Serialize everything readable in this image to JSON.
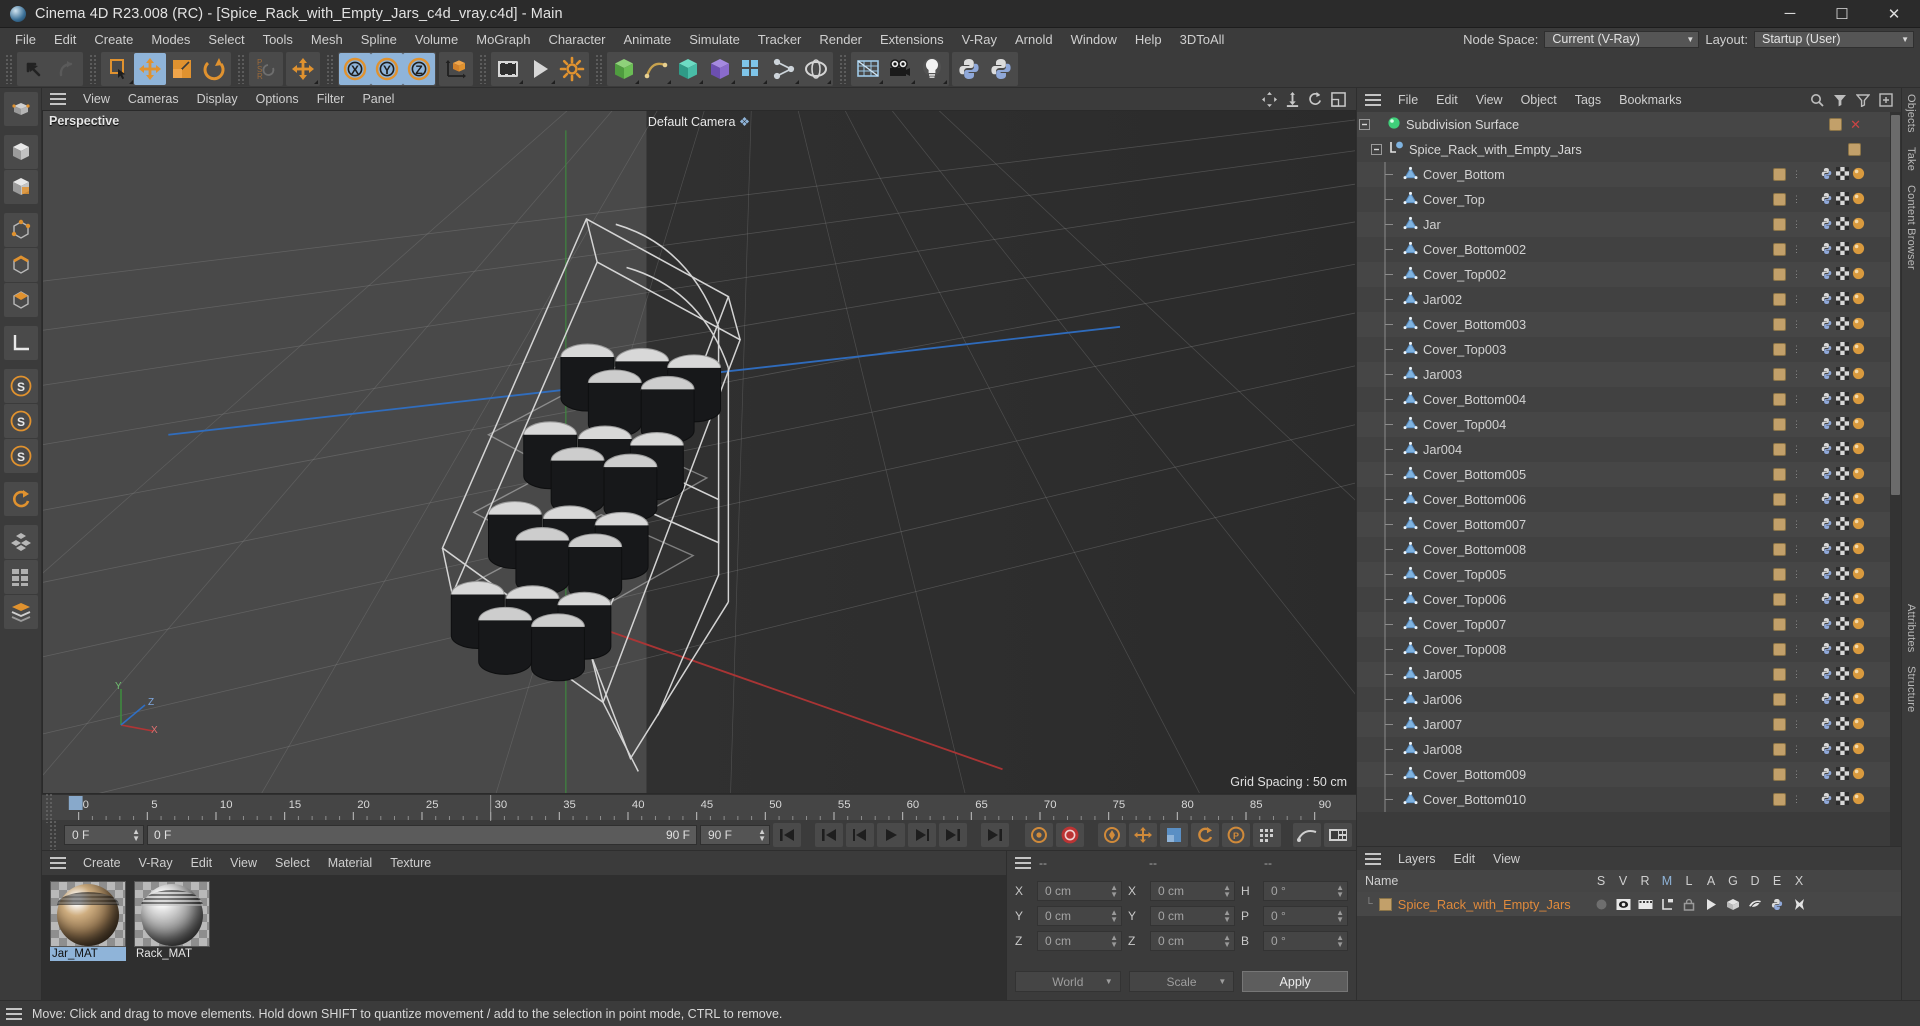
{
  "window": {
    "title": "Cinema 4D R23.008 (RC) - [Spice_Rack_with_Empty_Jars_c4d_vray.c4d] - Main",
    "minimize": "─",
    "maximize": "☐",
    "close": "✕"
  },
  "menubar": {
    "items": [
      "File",
      "Edit",
      "Create",
      "Modes",
      "Select",
      "Tools",
      "Mesh",
      "Spline",
      "Volume",
      "MoGraph",
      "Character",
      "Animate",
      "Simulate",
      "Tracker",
      "Render",
      "Extensions",
      "V-Ray",
      "Arnold",
      "Window",
      "Help",
      "3DToAll"
    ],
    "node_space_label": "Node Space:",
    "node_space_value": "Current (V-Ray)",
    "layout_label": "Layout:",
    "layout_value": "Startup (User)"
  },
  "toolbar": {
    "buttons": [
      {
        "name": "undo-button",
        "icon": "undo-icon",
        "active": false
      },
      {
        "name": "redo-button",
        "icon": "redo-icon",
        "active": false
      },
      {
        "name": "live-selection-button",
        "icon": "selection-icon",
        "active": false
      },
      {
        "name": "move-tool-button",
        "icon": "move-icon",
        "active": true
      },
      {
        "name": "scale-tool-button",
        "icon": "scale-icon",
        "active": false
      },
      {
        "name": "rotate-tool-button",
        "icon": "rotate-icon",
        "active": false
      },
      {
        "name": "psr-button",
        "icon": "psr-icon",
        "active": false
      },
      {
        "name": "move-axis-button",
        "icon": "move-icon",
        "active": false
      },
      {
        "name": "x-axis-lock-button",
        "icon": "x-axis-icon",
        "active": true
      },
      {
        "name": "y-axis-lock-button",
        "icon": "y-axis-icon",
        "active": true
      },
      {
        "name": "z-axis-lock-button",
        "icon": "z-axis-icon",
        "active": true
      },
      {
        "name": "world-object-coordinate-button",
        "icon": "world-axis-icon",
        "active": false
      },
      {
        "name": "render-view-button",
        "icon": "render-view-icon",
        "active": false
      },
      {
        "name": "render-region-button",
        "icon": "render-region-icon",
        "active": false
      },
      {
        "name": "render-settings-button",
        "icon": "render-settings-icon",
        "active": false
      },
      {
        "name": "cube-primitive-button",
        "icon": "cube-icon",
        "active": false
      },
      {
        "name": "spline-pen-button",
        "icon": "spline-icon",
        "active": false
      },
      {
        "name": "generators-button",
        "icon": "generator-icon",
        "active": false
      },
      {
        "name": "bend-deformer-button",
        "icon": "deformer-icon",
        "active": false
      },
      {
        "name": "array-button",
        "icon": "array-icon",
        "active": false
      },
      {
        "name": "scene-nodes-button",
        "icon": "scene-nodes-icon",
        "active": false
      },
      {
        "name": "mograph-button",
        "icon": "mograph-icon",
        "active": false
      },
      {
        "name": "field-button",
        "icon": "field-icon",
        "active": false
      },
      {
        "name": "camera-button",
        "icon": "camera-icon",
        "active": false
      },
      {
        "name": "light-button",
        "icon": "light-icon",
        "active": false
      },
      {
        "name": "python-button",
        "icon": "python-icon",
        "active": false
      },
      {
        "name": "python-generator-button",
        "icon": "python-icon",
        "active": false
      }
    ]
  },
  "lefttools": {
    "buttons": [
      {
        "name": "tool-makeeditable",
        "icon": "make-editable-icon"
      },
      {
        "name": "tool-model-mode",
        "icon": "model-mode-icon"
      },
      {
        "name": "tool-texture-mode",
        "icon": "texture-mode-icon"
      },
      {
        "name": "tool-point-mode",
        "icon": "point-mode-icon"
      },
      {
        "name": "tool-edge-mode",
        "icon": "edge-mode-icon"
      },
      {
        "name": "tool-polygon-mode",
        "icon": "polygon-mode-icon"
      },
      {
        "name": "tool-workplane",
        "icon": "workplane-icon"
      },
      {
        "name": "tool-enable-axis",
        "icon": "axis-icon"
      },
      {
        "name": "tool-snap-s1",
        "icon": "snap-icon"
      },
      {
        "name": "tool-snap-s2",
        "icon": "snap-icon"
      },
      {
        "name": "tool-snap-s3",
        "icon": "snap-icon"
      },
      {
        "name": "tool-quantize",
        "icon": "quantize-icon"
      },
      {
        "name": "tool-workplane-lock",
        "icon": "grid-icon"
      },
      {
        "name": "tool-viewport-solo",
        "icon": "solo-icon"
      },
      {
        "name": "tool-layers",
        "icon": "layers-icon"
      }
    ]
  },
  "viewport": {
    "menu": [
      "View",
      "Cameras",
      "Display",
      "Options",
      "Filter",
      "Panel"
    ],
    "label": "Perspective",
    "camera": "Default Camera",
    "grid_spacing": "Grid Spacing : 50 cm",
    "axis_labels": {
      "x": "X",
      "y": "Y",
      "z": "Z"
    },
    "corner_icons": [
      "pan-view-icon",
      "zoom-view-icon",
      "rotate-view-icon",
      "maximize-view-icon"
    ]
  },
  "timeline": {
    "ticks": [
      "0",
      "5",
      "10",
      "15",
      "20",
      "25",
      "30",
      "35",
      "40",
      "45",
      "50",
      "55",
      "60",
      "65",
      "70",
      "75",
      "80",
      "85",
      "90"
    ],
    "current_frame_field": "0 F",
    "preview_min": "0 F",
    "preview_max": "90 F",
    "end_frame_field": "90 F",
    "current_frame_left": "0 F",
    "playhead_frame": 0,
    "transport": [
      "go-to-start",
      "rewind",
      "step-back",
      "play",
      "step-forward",
      "go-to-end",
      "go-to-end-extra"
    ],
    "record_buttons": [
      "autokey-icon",
      "record-icon",
      "keyframe-selection-icon",
      "position-key-icon",
      "scale-key-icon",
      "rotation-key-icon",
      "param-key-icon",
      "pla-key-icon",
      "animation-layer-icon",
      "timeline-icon"
    ]
  },
  "materials": {
    "menu": [
      "Create",
      "V-Ray",
      "Edit",
      "View",
      "Select",
      "Material",
      "Texture"
    ],
    "items": [
      {
        "name": "Jar_MAT",
        "selected": true,
        "color": "#b99a72"
      },
      {
        "name": "Rack_MAT",
        "selected": false,
        "color": "#c9c9c9"
      }
    ]
  },
  "coordinates": {
    "header_dashes": [
      "--",
      "--",
      "--"
    ],
    "rows": [
      {
        "pos_label": "X",
        "pos_value": "0 cm",
        "size_label": "X",
        "size_value": "0 cm",
        "rot_label": "H",
        "rot_value": "0 °"
      },
      {
        "pos_label": "Y",
        "pos_value": "0 cm",
        "size_label": "Y",
        "size_value": "0 cm",
        "rot_label": "P",
        "rot_value": "0 °"
      },
      {
        "pos_label": "Z",
        "pos_value": "0 cm",
        "size_label": "Z",
        "size_value": "0 cm",
        "rot_label": "B",
        "rot_value": "0 °"
      }
    ],
    "coord_system": "World",
    "size_mode": "Scale",
    "apply_label": "Apply"
  },
  "object_manager": {
    "menu": [
      "File",
      "Edit",
      "View",
      "Object",
      "Tags",
      "Bookmarks"
    ],
    "header_icons": [
      "search-icon",
      "filter-a-icon",
      "filter-b-icon",
      "expand-icon"
    ],
    "root": {
      "name": "Subdivision Surface",
      "icon": "subdivision-surface-icon",
      "x_mark": true
    },
    "group": {
      "name": "Spice_Rack_with_Empty_Jars",
      "icon": "null-object-icon"
    },
    "items": [
      "Cover_Bottom",
      "Cover_Top",
      "Jar",
      "Cover_Bottom002",
      "Cover_Top002",
      "Jar002",
      "Cover_Bottom003",
      "Cover_Top003",
      "Jar003",
      "Cover_Bottom004",
      "Cover_Top004",
      "Jar004",
      "Cover_Bottom005",
      "Cover_Bottom006",
      "Cover_Bottom007",
      "Cover_Bottom008",
      "Cover_Top005",
      "Cover_Top006",
      "Cover_Top007",
      "Cover_Top008",
      "Jar005",
      "Jar006",
      "Jar007",
      "Jar008",
      "Cover_Bottom009",
      "Cover_Bottom010"
    ]
  },
  "layers": {
    "menu": [
      "Layers",
      "Edit",
      "View"
    ],
    "columns": [
      "Name",
      "S",
      "V",
      "R",
      "M",
      "L",
      "A",
      "G",
      "D",
      "E",
      "X"
    ],
    "rows": [
      {
        "name": "Spice_Rack_with_Empty_Jars",
        "color": "#c2a06a"
      }
    ]
  },
  "right_tabs": [
    "Objects",
    "Take",
    "Content Browser",
    "Attributes",
    "Structure"
  ],
  "statusbar": {
    "text": "Move: Click and drag to move elements. Hold down SHIFT to quantize movement / add to the selection in point mode, CTRL to remove."
  },
  "colors": {
    "accent_blue": "#8fb4d9",
    "orange": "#e08a3c",
    "panel_bg": "#3b3b3b",
    "dark_bg": "#2f2f2f"
  }
}
